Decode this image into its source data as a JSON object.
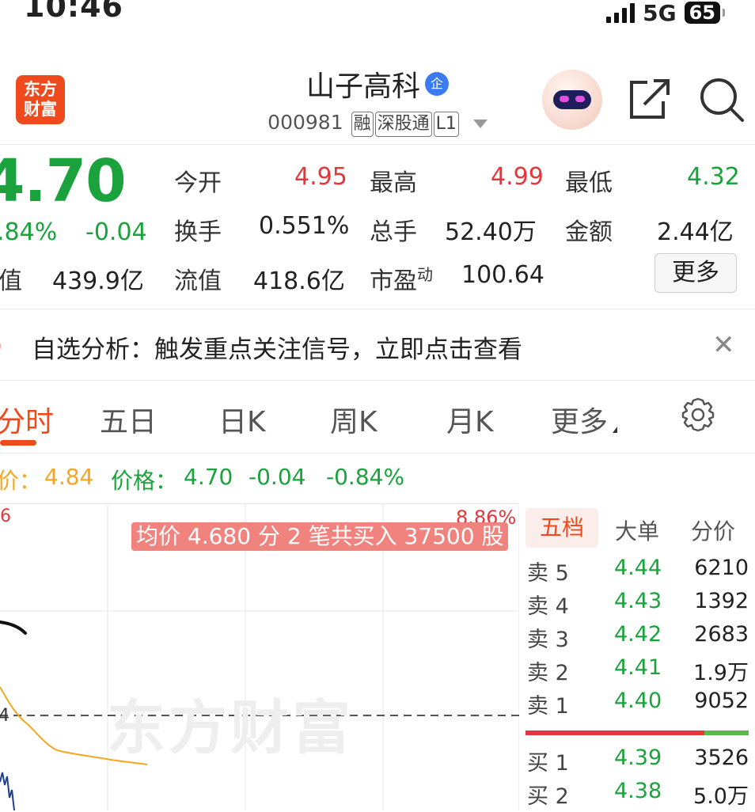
{
  "status_bar": {
    "time": "10:46",
    "network": "5G",
    "battery": "65"
  },
  "header": {
    "logo_line1": "东方",
    "logo_line2": "财富",
    "stock_name": "山子高科",
    "badge": "企",
    "code": "000981",
    "tags": [
      "融",
      "深股通",
      "L1"
    ]
  },
  "quote": {
    "price": "4.70",
    "change_pct": ".84%",
    "change": "-0.04",
    "mktcap_label": "值",
    "mktcap_value": "439.9亿",
    "open_label": "今开",
    "open_value": "4.95",
    "high_label": "最高",
    "high_value": "4.99",
    "low_label": "最低",
    "low_value": "4.32",
    "turnover_label": "换手",
    "turnover_value": "0.551%",
    "volume_label": "总手",
    "volume_value": "52.40万",
    "amount_label": "金额",
    "amount_value": "2.44亿",
    "float_label": "流值",
    "float_value": "418.6亿",
    "pe_label": "市盈",
    "pe_sup": "动",
    "pe_value": "100.64",
    "more_label": "更多"
  },
  "notice": {
    "text": "自选分析：触发重点关注信号，立即点击查看"
  },
  "tabs": [
    "分时",
    "五日",
    "日K",
    "周K",
    "月K",
    "更多"
  ],
  "price_line": {
    "avg_label": "价：",
    "avg_value": "4.84",
    "price_label": "价格：",
    "price_value": "4.70",
    "change": "-0.04",
    "change_pct": "-0.84%"
  },
  "chart": {
    "top_left_label": "6",
    "top_right_label": "8.86%",
    "mid_left_label": "4",
    "watermark": "东方财富",
    "tooltip": "均价 4.680  分 2 笔共买入 37500 股",
    "colors": {
      "avg_line": "#f5a623",
      "price_line": "#1c3f94",
      "ref_line": "#555555"
    }
  },
  "order_book": {
    "tabs": [
      "五档",
      "大单",
      "分价"
    ],
    "asks": [
      {
        "label": "卖 5",
        "price": "4.44",
        "vol": "6210"
      },
      {
        "label": "卖 4",
        "price": "4.43",
        "vol": "1392"
      },
      {
        "label": "卖 3",
        "price": "4.42",
        "vol": "2683"
      },
      {
        "label": "卖 2",
        "price": "4.41",
        "vol": "1.9万"
      },
      {
        "label": "卖 1",
        "price": "4.40",
        "vol": "9052"
      }
    ],
    "bids": [
      {
        "label": "买 1",
        "price": "4.39",
        "vol": "3526"
      },
      {
        "label": "买 2",
        "price": "4.38",
        "vol": "5.0万"
      }
    ]
  }
}
